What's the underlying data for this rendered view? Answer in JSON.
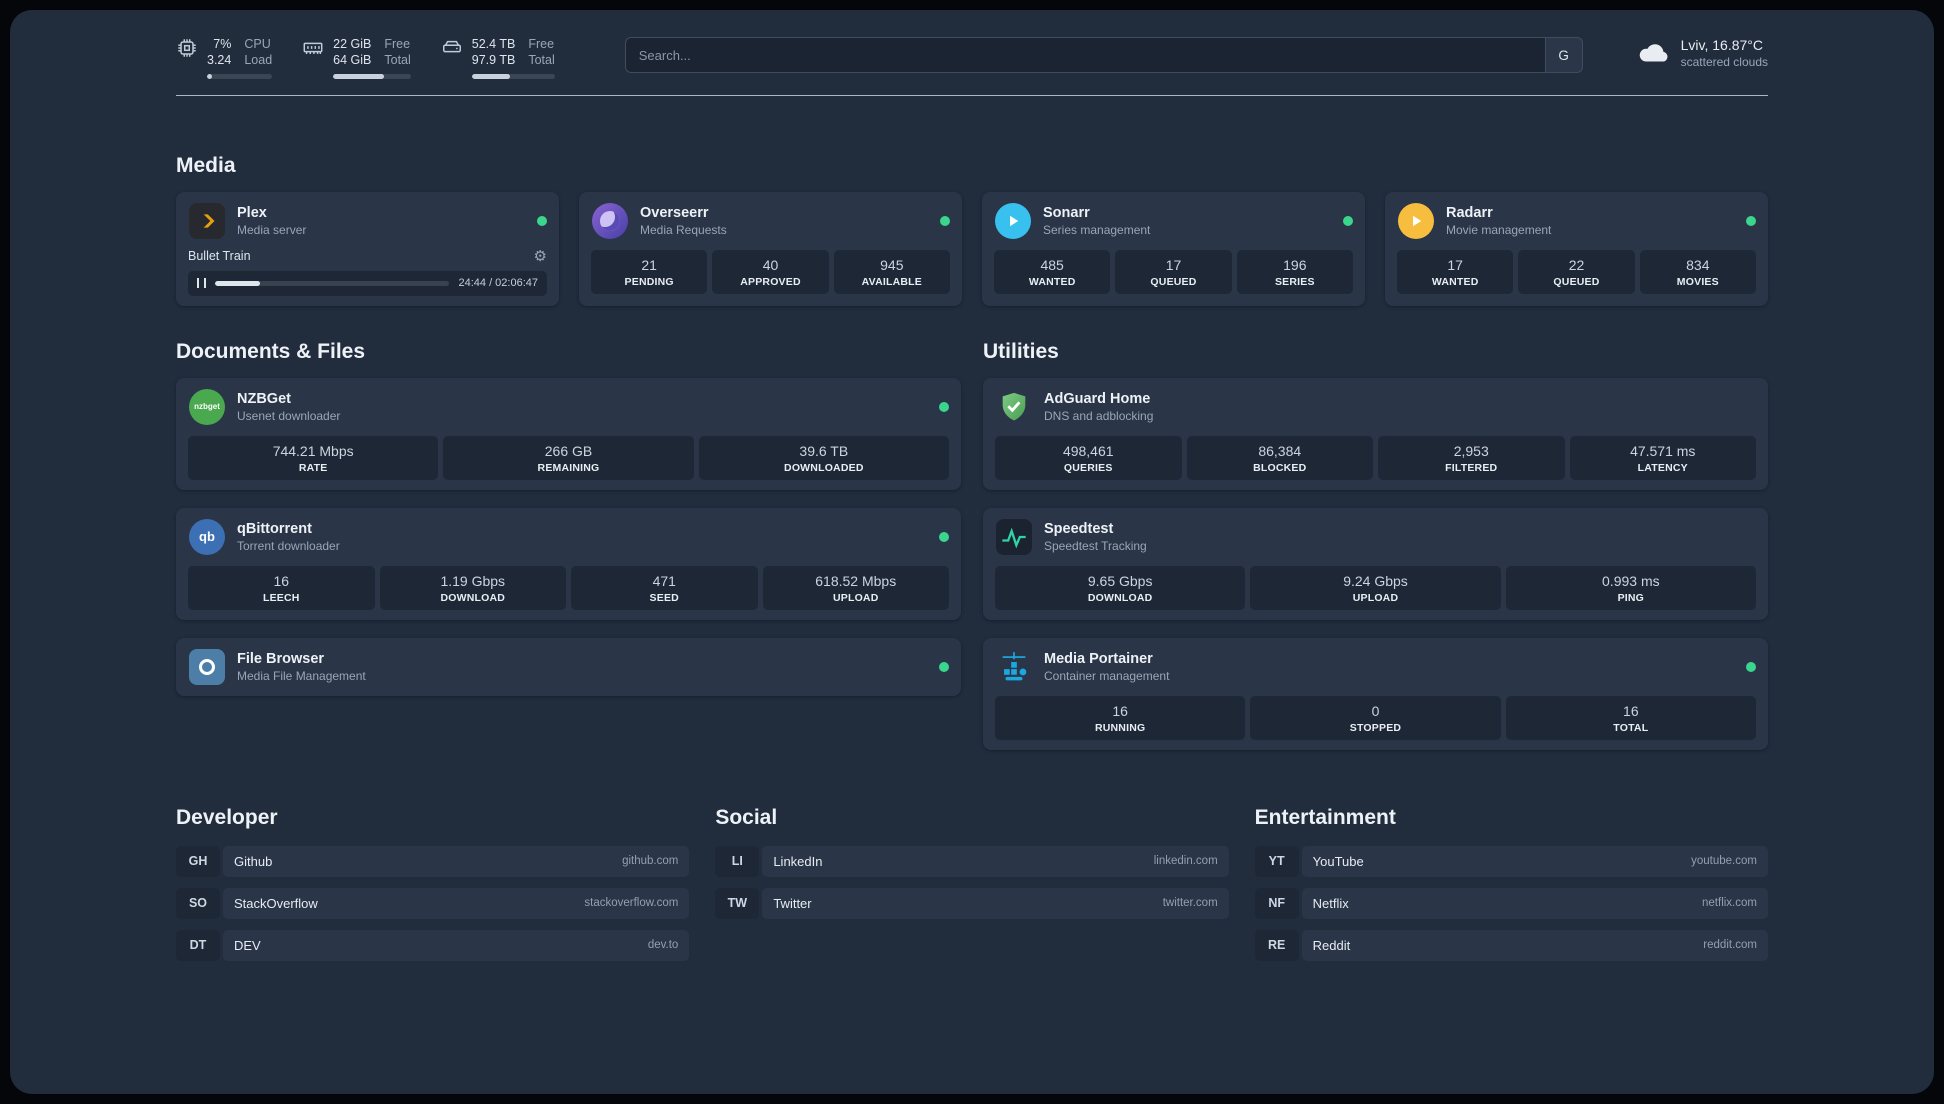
{
  "topbar": {
    "cpu": {
      "line1": "7%",
      "line2": "3.24",
      "label1": "CPU",
      "label2": "Load",
      "percent": 7
    },
    "memory": {
      "line1": "22 GiB",
      "line2": "64 GiB",
      "label1": "Free",
      "label2": "Total",
      "percent": 66
    },
    "disk": {
      "line1": "52.4 TB",
      "line2": "97.9 TB",
      "label1": "Free",
      "label2": "Total",
      "percent": 46
    },
    "search": {
      "placeholder": "Search...",
      "provider_label": "G"
    },
    "weather": {
      "location": "Lviv, 16.87°C",
      "condition": "scattered clouds"
    }
  },
  "media": {
    "title": "Media",
    "plex": {
      "name": "Plex",
      "subtitle": "Media server",
      "now_playing": "Bullet Train",
      "time": "24:44 / 02:06:47",
      "progress_percent": 19
    },
    "overseerr": {
      "name": "Overseerr",
      "subtitle": "Media Requests",
      "stats": [
        {
          "value": "21",
          "label": "PENDING"
        },
        {
          "value": "40",
          "label": "APPROVED"
        },
        {
          "value": "945",
          "label": "AVAILABLE"
        }
      ]
    },
    "sonarr": {
      "name": "Sonarr",
      "subtitle": "Series management",
      "stats": [
        {
          "value": "485",
          "label": "WANTED"
        },
        {
          "value": "17",
          "label": "QUEUED"
        },
        {
          "value": "196",
          "label": "SERIES"
        }
      ]
    },
    "radarr": {
      "name": "Radarr",
      "subtitle": "Movie management",
      "stats": [
        {
          "value": "17",
          "label": "WANTED"
        },
        {
          "value": "22",
          "label": "QUEUED"
        },
        {
          "value": "834",
          "label": "MOVIES"
        }
      ]
    }
  },
  "documents": {
    "title": "Documents & Files",
    "nzbget": {
      "name": "NZBGet",
      "subtitle": "Usenet downloader",
      "icon_text": "nzbget",
      "stats": [
        {
          "value": "744.21 Mbps",
          "label": "RATE"
        },
        {
          "value": "266 GB",
          "label": "REMAINING"
        },
        {
          "value": "39.6 TB",
          "label": "DOWNLOADED"
        }
      ]
    },
    "qbittorrent": {
      "name": "qBittorrent",
      "subtitle": "Torrent downloader",
      "icon_text": "qb",
      "stats": [
        {
          "value": "16",
          "label": "LEECH"
        },
        {
          "value": "1.19 Gbps",
          "label": "DOWNLOAD"
        },
        {
          "value": "471",
          "label": "SEED"
        },
        {
          "value": "618.52 Mbps",
          "label": "UPLOAD"
        }
      ]
    },
    "filebrowser": {
      "name": "File Browser",
      "subtitle": "Media File Management"
    }
  },
  "utilities": {
    "title": "Utilities",
    "adguard": {
      "name": "AdGuard Home",
      "subtitle": "DNS and adblocking",
      "stats": [
        {
          "value": "498,461",
          "label": "QUERIES"
        },
        {
          "value": "86,384",
          "label": "BLOCKED"
        },
        {
          "value": "2,953",
          "label": "FILTERED"
        },
        {
          "value": "47.571 ms",
          "label": "LATENCY"
        }
      ]
    },
    "speedtest": {
      "name": "Speedtest",
      "subtitle": "Speedtest Tracking",
      "stats": [
        {
          "value": "9.65 Gbps",
          "label": "DOWNLOAD"
        },
        {
          "value": "9.24 Gbps",
          "label": "UPLOAD"
        },
        {
          "value": "0.993 ms",
          "label": "PING"
        }
      ]
    },
    "portainer": {
      "name": "Media Portainer",
      "subtitle": "Container management",
      "stats": [
        {
          "value": "16",
          "label": "RUNNING"
        },
        {
          "value": "0",
          "label": "STOPPED"
        },
        {
          "value": "16",
          "label": "TOTAL"
        }
      ]
    }
  },
  "bookmarks": [
    {
      "title": "Developer",
      "items": [
        {
          "abbr": "GH",
          "name": "Github",
          "url": "github.com"
        },
        {
          "abbr": "SO",
          "name": "StackOverflow",
          "url": "stackoverflow.com"
        },
        {
          "abbr": "DT",
          "name": "DEV",
          "url": "dev.to"
        }
      ]
    },
    {
      "title": "Social",
      "items": [
        {
          "abbr": "LI",
          "name": "LinkedIn",
          "url": "linkedin.com"
        },
        {
          "abbr": "TW",
          "name": "Twitter",
          "url": "twitter.com"
        }
      ]
    },
    {
      "title": "Entertainment",
      "items": [
        {
          "abbr": "YT",
          "name": "YouTube",
          "url": "youtube.com"
        },
        {
          "abbr": "NF",
          "name": "Netflix",
          "url": "netflix.com"
        },
        {
          "abbr": "RE",
          "name": "Reddit",
          "url": "reddit.com"
        }
      ]
    }
  ],
  "colors": {
    "status_online": "#3bd68e",
    "plex_accent": "#e5a00d",
    "overseerr_purple": "#5a4bb4",
    "sonarr_blue": "#38c1ef",
    "radarr_yellow": "#f7bd3e",
    "nzbget_green": "#4aa84e",
    "qbittorrent_blue": "#3d6fb4",
    "adguard_green": "#68bd71",
    "speedtest_wave": "#2fd3a4",
    "portainer_blue": "#1ba7e0",
    "filebrowser_blue": "#4d7ea8"
  }
}
